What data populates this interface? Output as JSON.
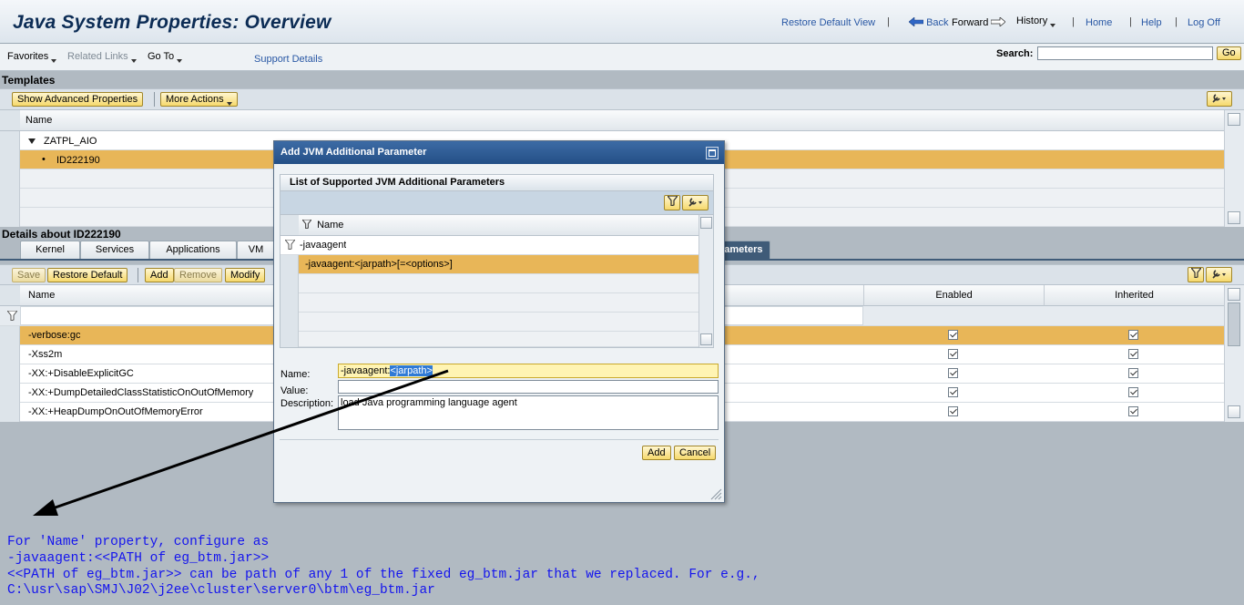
{
  "header": {
    "title": "Java System Properties: Overview",
    "restore_default_view": "Restore Default View",
    "back": "Back",
    "forward": "Forward",
    "history": "History",
    "home": "Home",
    "help": "Help",
    "logoff": "Log Off",
    "sep": "|"
  },
  "toolbar": {
    "favorites": "Favorites",
    "related_links": "Related Links",
    "go_to": "Go To",
    "support_details": "Support Details",
    "search_label": "Search:",
    "search_value": "",
    "go_button": "Go"
  },
  "templates": {
    "section_title": "Templates",
    "show_advanced": "Show Advanced Properties",
    "more_actions": "More Actions",
    "column_name": "Name",
    "rows": [
      {
        "label": "ZATPL_AIO"
      },
      {
        "label": "ID222190"
      }
    ]
  },
  "details": {
    "section_title": "Details about ID222190",
    "tabs": [
      "Kernel",
      "Services",
      "Applications",
      "VM",
      "rameters"
    ],
    "buttons": {
      "save": "Save",
      "restore_default": "Restore Default",
      "add": "Add",
      "remove": "Remove",
      "modify": "Modify"
    },
    "columns": {
      "name": "Name",
      "enabled": "Enabled",
      "inherited": "Inherited"
    },
    "rows": [
      {
        "name": "-verbose:gc",
        "enabled": true,
        "inherited": true
      },
      {
        "name": "-Xss2m",
        "enabled": true,
        "inherited": true
      },
      {
        "name": "-XX:+DisableExplicitGC",
        "enabled": true,
        "inherited": true
      },
      {
        "name": "-XX:+DumpDetailedClassStatisticOnOutOfMemory",
        "enabled": true,
        "inherited": true
      },
      {
        "name": "-XX:+HeapDumpOnOutOfMemoryError",
        "enabled": true,
        "inherited": true
      }
    ]
  },
  "dialog": {
    "title": "Add JVM Additional Parameter",
    "list_title": "List of Supported JVM Additional Parameters",
    "column_name": "Name",
    "filter_value": "-javaagent",
    "list_rows": [
      {
        "name": "-javaagent:<jarpath>[=<options>]"
      }
    ],
    "name_label": "Name:",
    "name_prefix": "-javaagent:",
    "name_selected": "<jarpath>",
    "value_label": "Value:",
    "value_value": "",
    "description_label": "Description:",
    "description_value": "load Java programming language agent",
    "add_button": "Add",
    "cancel_button": "Cancel"
  },
  "annotation": {
    "lines": [
      "For 'Name' property, configure as",
      "-javaagent:<<PATH of eg_btm.jar>>",
      "<<PATH of eg_btm.jar>> can be path of any 1 of the fixed eg_btm.jar that we replaced. For e.g.,",
      "C:\\usr\\sap\\SMJ\\J02\\j2ee\\cluster\\server0\\btm\\eg_btm.jar"
    ],
    "color": "#1414ee"
  },
  "colors": {
    "selected_row": "#e8b658",
    "dialog_title": "#2d5a92",
    "link": "#2857a4",
    "button": "#f6d96c"
  }
}
